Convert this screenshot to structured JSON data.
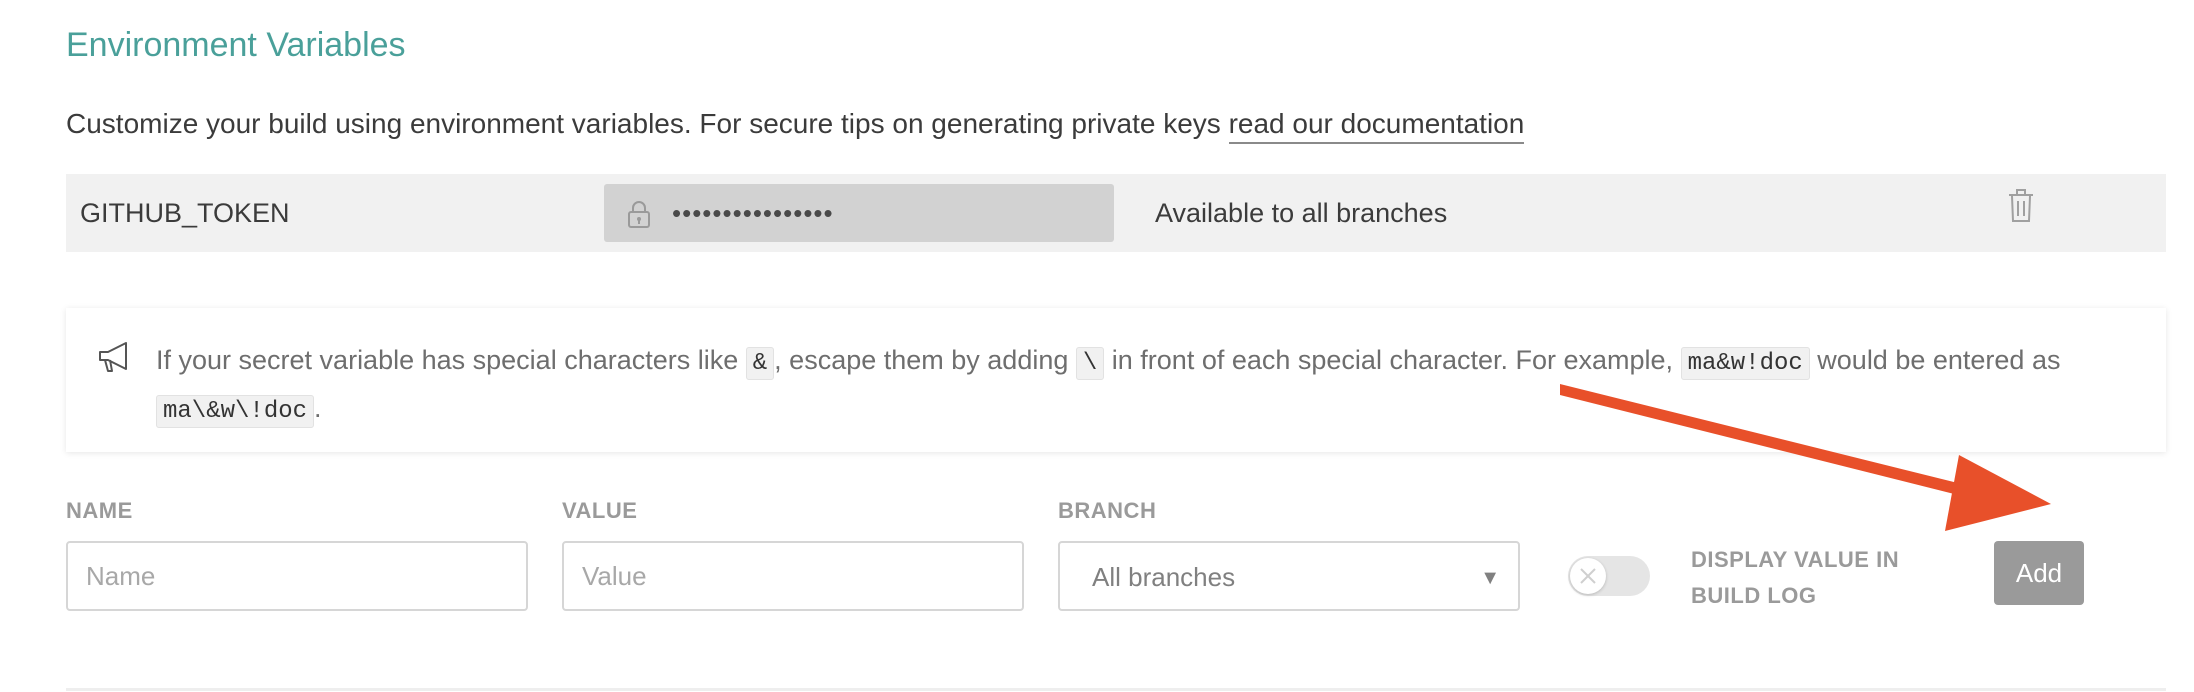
{
  "section": {
    "title": "Environment Variables",
    "intro_text": "Customize your build using environment variables. For secure tips on generating private keys ",
    "intro_link": "read our documentation"
  },
  "env_var": {
    "name": "GITHUB_TOKEN",
    "masked_value": "••••••••••••••••",
    "branch": "Available to all branches"
  },
  "note": {
    "part1": "If your secret variable has special characters like ",
    "code1": "&",
    "part2": ", escape them by adding ",
    "code2": "\\",
    "part3": " in front of each special character. For example, ",
    "code3": "ma&w!doc",
    "part4": " would be entered as ",
    "code4": "ma\\&w\\!doc",
    "part5": "."
  },
  "form": {
    "name_label": "NAME",
    "name_placeholder": "Name",
    "value_label": "VALUE",
    "value_placeholder": "Value",
    "branch_label": "BRANCH",
    "branch_selected": "All branches",
    "display_toggle_label": "DISPLAY VALUE IN BUILD LOG",
    "display_toggle_on": false,
    "add_label": "Add"
  },
  "colors": {
    "title": "#4aa09a",
    "annotation_arrow": "#e8502a",
    "add_button": "#9a9a9a"
  },
  "icons": {
    "lock": "lock-icon",
    "trash": "trash-icon",
    "megaphone": "megaphone-icon",
    "dropdown": "dropdown-arrow-icon",
    "toggle_off": "close-icon"
  }
}
